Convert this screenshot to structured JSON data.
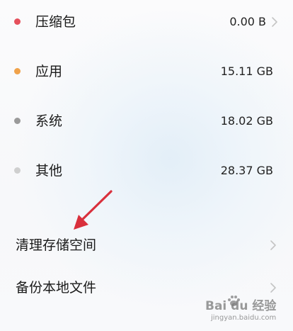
{
  "storage": {
    "items": [
      {
        "label": "压缩包",
        "value": "0.00 B",
        "color": "#e5505c"
      },
      {
        "label": "应用",
        "value": "15.11 GB",
        "color": "#f0a24a"
      },
      {
        "label": "系统",
        "value": "18.02 GB",
        "color": "#9a9a9a"
      },
      {
        "label": "其他",
        "value": "28.37 GB",
        "color": "#cfcfcf"
      }
    ]
  },
  "actions": {
    "clean": "清理存储空间",
    "backup": "备份本地文件"
  },
  "watermark": {
    "logo": "Bai du 经验",
    "url": "jingyan.baidu.com"
  },
  "annotation_color": "#d9303c"
}
